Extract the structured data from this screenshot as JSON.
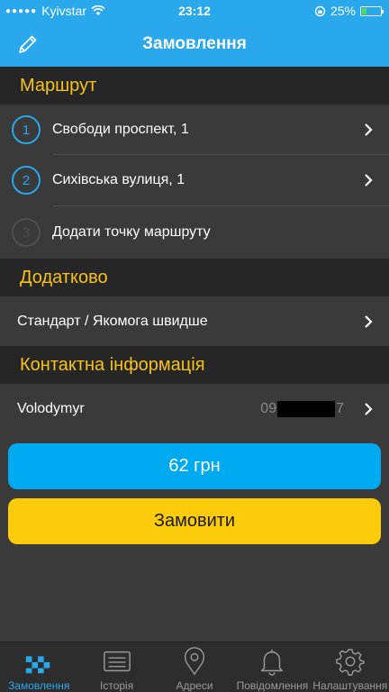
{
  "status_bar": {
    "carrier": "Kyivstar",
    "time": "23:12",
    "battery_percent": "25%",
    "battery_level": 0.25
  },
  "header": {
    "title": "Замовлення"
  },
  "sections": {
    "route": {
      "title": "Маршрут",
      "points": [
        {
          "number": "1",
          "label": "Свободи проспект, 1"
        },
        {
          "number": "2",
          "label": "Сихівська вулиця, 1"
        },
        {
          "number": "3",
          "label": "Додати точку маршруту"
        }
      ]
    },
    "extra": {
      "title": "Додатково",
      "option": "Стандарт / Якомога швидше"
    },
    "contact": {
      "title": "Контактна інформація",
      "name": "Volodymyr",
      "phone_prefix": "09",
      "phone_suffix": "7"
    }
  },
  "buttons": {
    "price": "62 грн",
    "order": "Замовити"
  },
  "tabs": [
    {
      "label": "Замовлення",
      "icon": "taxi-checker-icon"
    },
    {
      "label": "Історія",
      "icon": "list-icon"
    },
    {
      "label": "Адреси",
      "icon": "map-pin-icon"
    },
    {
      "label": "Повідомлення",
      "icon": "bell-icon"
    },
    {
      "label": "Налаштування",
      "icon": "gear-icon"
    }
  ],
  "colors": {
    "accent_blue": "#29a8ec",
    "accent_yellow": "#fccb0a",
    "section_text": "#f7c21a",
    "background": "#3a3a3a"
  }
}
